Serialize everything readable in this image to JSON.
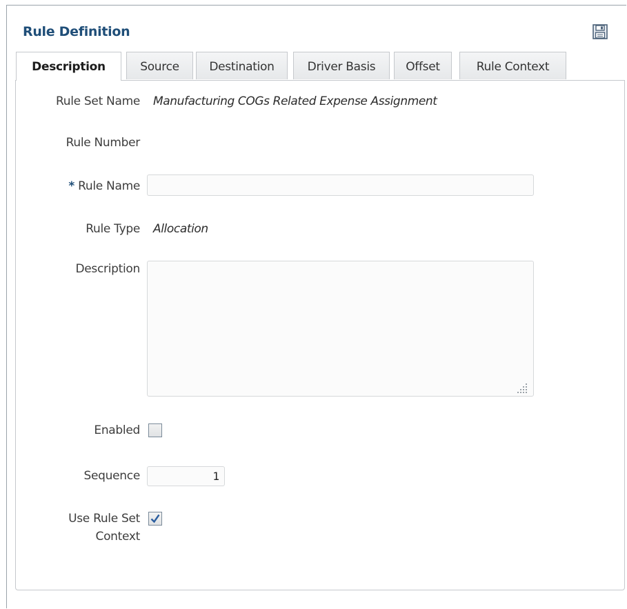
{
  "header": {
    "title": "Rule Definition",
    "save_icon": "save-icon"
  },
  "tabs": [
    {
      "label": "Description",
      "active": true
    },
    {
      "label": "Source",
      "active": false
    },
    {
      "label": "Destination",
      "active": false
    },
    {
      "label": "Driver Basis",
      "active": false
    },
    {
      "label": "Offset",
      "active": false
    },
    {
      "label": "Rule Context",
      "active": false
    }
  ],
  "form": {
    "rule_set_name_label": "Rule Set Name",
    "rule_set_name_value": "Manufacturing COGs Related Expense Assignment",
    "rule_number_label": "Rule Number",
    "rule_number_value": "",
    "rule_name_required_marker": "*",
    "rule_name_label": "Rule Name",
    "rule_name_value": "",
    "rule_type_label": "Rule Type",
    "rule_type_value": "Allocation",
    "description_label": "Description",
    "description_value": "",
    "enabled_label": "Enabled",
    "enabled_checked": false,
    "sequence_label": "Sequence",
    "sequence_value": "1",
    "use_rule_set_context_label_line1": "Use Rule Set",
    "use_rule_set_context_label_line2": "Context",
    "use_rule_set_context_checked": true
  },
  "colors": {
    "title": "#1f4e78",
    "border": "#c5c8cc",
    "check": "#2a5d9f"
  }
}
